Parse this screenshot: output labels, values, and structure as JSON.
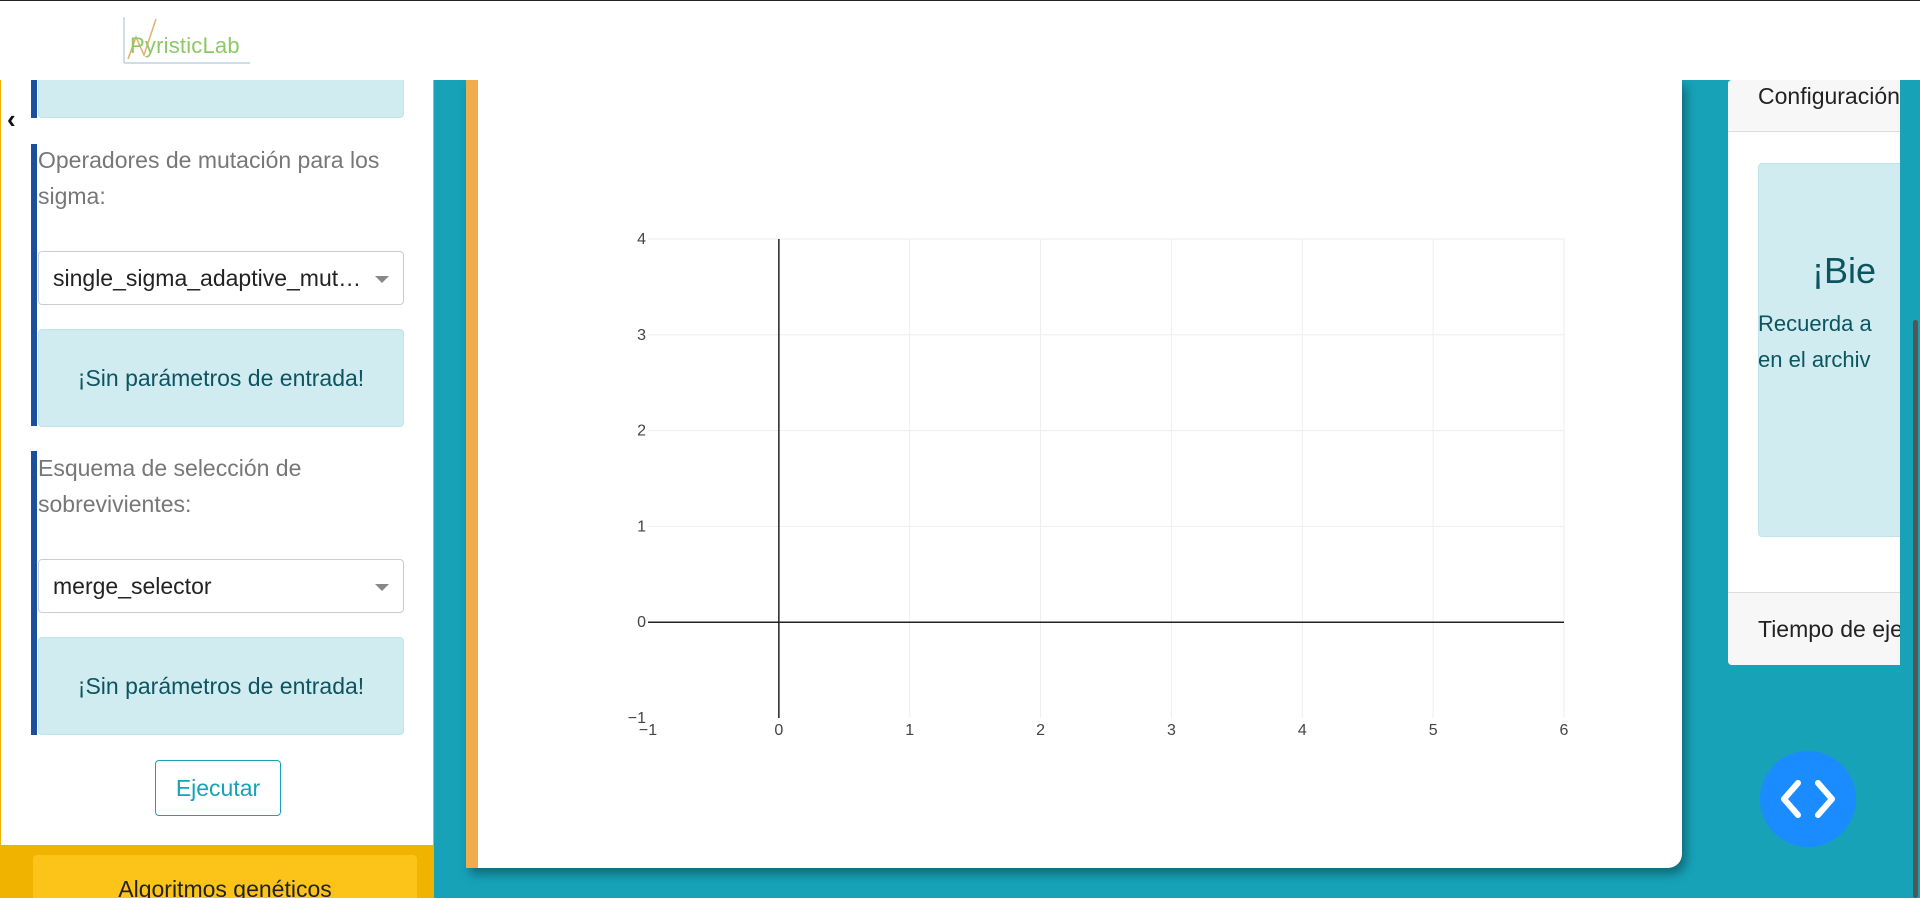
{
  "header": {
    "logo_text": "PyristicLab"
  },
  "sidebar": {
    "top_alert": "",
    "sigma_mutation": {
      "label": "Operadores de mutación para los sigma:",
      "selected": "single_sigma_adaptive_mutation",
      "info": "¡Sin parámetros de entrada!"
    },
    "survivor_selection": {
      "label": "Esquema de selección de sobrevivientes:",
      "selected": "merge_selector",
      "info": "¡Sin parámetros de entrada!"
    },
    "run_label": "Ejecutar",
    "footer_item": "Algoritmos genéticos"
  },
  "right_panel": {
    "header": "Configuración",
    "success_title": "¡Bie",
    "success_text_1": "Recuerda a",
    "success_text_2": "en el archiv",
    "footer": "Tiempo de eje"
  },
  "icons": {
    "collapse": "chevron-left-icon",
    "fab": "code-icon"
  },
  "colors": {
    "teal": "#17a2b8",
    "accent_orange": "#f0ad4e",
    "sidebar_yellow": "#f0b400",
    "fab_blue": "#1a8cff"
  },
  "chart_data": {
    "type": "line",
    "series": [],
    "xlim": [
      -1,
      6
    ],
    "ylim": [
      -1,
      4
    ],
    "xticks": [
      "−1",
      "0",
      "1",
      "2",
      "3",
      "4",
      "5",
      "6"
    ],
    "yticks": [
      "−1",
      "0",
      "1",
      "2",
      "3",
      "4"
    ],
    "grid": true
  }
}
